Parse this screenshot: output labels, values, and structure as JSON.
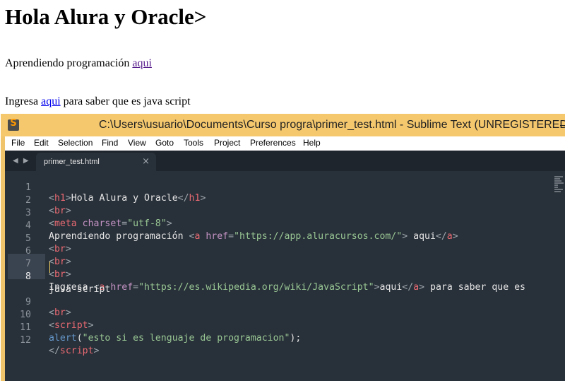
{
  "page": {
    "heading": "Hola Alura y Oracle>",
    "p1_text": "Aprendiendo programación ",
    "p1_link": "aqui",
    "p2_prefix": "Ingresa ",
    "p2_link": "aqui",
    "p2_suffix": " para saber que es java script"
  },
  "window": {
    "title": "C:\\Users\\usuario\\Documents\\Curso progra\\primer_test.html - Sublime Text (UNREGISTERED)",
    "app_icon": "S"
  },
  "menu": [
    "File",
    "Edit",
    "Selection",
    "Find",
    "View",
    "Goto",
    "Tools",
    "Project",
    "Preferences",
    "Help"
  ],
  "tab": {
    "name": "primer_test.html",
    "close": "×",
    "nav": "◀ ▶"
  },
  "gutter": [
    "1",
    "2",
    "3",
    "4",
    "5",
    "6",
    "7",
    "8",
    "",
    "9",
    "10",
    "11",
    "12"
  ],
  "code": {
    "l1": {
      "lt": "<",
      "tag": "h1",
      "gt": ">",
      "text": "Hola Alura y Oracle",
      "clt": "</",
      "ctag": "h1",
      "cgt": ">"
    },
    "l2": {
      "lt": "<",
      "tag": "br",
      "gt": ">"
    },
    "l3": {
      "lt": "<",
      "tag": "meta",
      "attr": " charset",
      "eq": "=",
      "val": "\"utf-8\"",
      "gt": ">"
    },
    "l4": {
      "text": "Aprendiendo programación ",
      "lt": "<",
      "tag": "a",
      "attr": " href",
      "eq": "=",
      "val": "\"https://app.aluracursos.com/\"",
      "gt": ">",
      "text2": " aqui",
      "clt": "</",
      "ctag": "a",
      "cgt": ">"
    },
    "l5": {
      "lt": "<",
      "tag": "br",
      "gt": ">"
    },
    "l6": {
      "lt": "<",
      "tag": "br",
      "gt": ">"
    },
    "l7": {
      "lt": "<",
      "tag": "br",
      "gt": ">"
    },
    "l8": {
      "text": "Ingresa ",
      "lt": "<",
      "tag": "a",
      "attr": " href",
      "eq": "=",
      "val": "\"https://es.wikipedia.org/wiki/JavaScript\"",
      "gt": ">",
      "text2": "aqui",
      "clt": "</",
      "ctag": "a",
      "cgt": ">",
      "text3": " para saber que es"
    },
    "l8b": {
      "text": "java script"
    },
    "l9": {
      "lt": "<",
      "tag": "br",
      "gt": ">"
    },
    "l10": {
      "lt": "<",
      "tag": "script",
      "gt": ">"
    },
    "l11": {
      "fn": "alert",
      "open": "(",
      "str": "\"esto si es lenguaje de programacion\"",
      "close": ");"
    },
    "l12": {
      "lt": "</",
      "tag": "script",
      "gt": ">"
    }
  }
}
